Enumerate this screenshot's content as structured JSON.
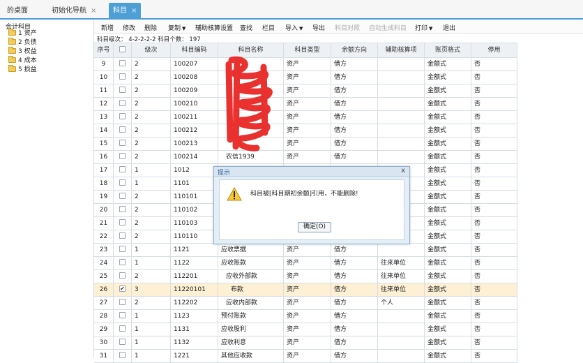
{
  "tabs": [
    {
      "label": "的桌面",
      "closable": false,
      "active": false
    },
    {
      "label": "初始化导航",
      "closable": true,
      "active": false
    },
    {
      "label": "科目",
      "closable": true,
      "active": true
    }
  ],
  "sidebar": {
    "root": "会计科目",
    "items": [
      {
        "label": "1 资产"
      },
      {
        "label": "2 负债"
      },
      {
        "label": "3 权益"
      },
      {
        "label": "4 成本"
      },
      {
        "label": "5 损益"
      }
    ]
  },
  "toolbar": {
    "add": "新增",
    "edit": "修改",
    "delete": "删除",
    "copy": "复制",
    "aux_settings": "辅助核算设置",
    "find": "查找",
    "columns": "栏目",
    "import": "导入",
    "export": "导出",
    "subject_match": "科目对照",
    "auto_generate": "自动生成科目",
    "print": "打印",
    "exit": "退出"
  },
  "summary": "科目级次： 4-2-2-2-2  科目个数： 197",
  "table": {
    "headers": [
      "序号",
      "",
      "级次",
      "科目编码",
      "科目名称",
      "科目类型",
      "余额方向",
      "辅助核算项",
      "账页格式",
      "停用"
    ],
    "rows": [
      {
        "seq": "9",
        "checked": false,
        "level": "2",
        "code": "100207",
        "name": "",
        "type": "资产",
        "dir": "借方",
        "aux": "",
        "format": "金额式",
        "disabled": "否"
      },
      {
        "seq": "10",
        "checked": false,
        "level": "2",
        "code": "100208",
        "name": "",
        "type": "资产",
        "dir": "借方",
        "aux": "",
        "format": "金额式",
        "disabled": "否"
      },
      {
        "seq": "11",
        "checked": false,
        "level": "2",
        "code": "100209",
        "name": "",
        "type": "资产",
        "dir": "借方",
        "aux": "",
        "format": "金额式",
        "disabled": "否"
      },
      {
        "seq": "12",
        "checked": false,
        "level": "2",
        "code": "100210",
        "name": "",
        "type": "资产",
        "dir": "借方",
        "aux": "",
        "format": "金额式",
        "disabled": "否"
      },
      {
        "seq": "13",
        "checked": false,
        "level": "2",
        "code": "100211",
        "name": "",
        "type": "资产",
        "dir": "借方",
        "aux": "",
        "format": "金额式",
        "disabled": "否"
      },
      {
        "seq": "14",
        "checked": false,
        "level": "2",
        "code": "100212",
        "name": "",
        "type": "资产",
        "dir": "借方",
        "aux": "",
        "format": "金额式",
        "disabled": "否"
      },
      {
        "seq": "15",
        "checked": false,
        "level": "2",
        "code": "100213",
        "name": "",
        "type": "资产",
        "dir": "借方",
        "aux": "",
        "format": "金额式",
        "disabled": "否"
      },
      {
        "seq": "16",
        "checked": false,
        "level": "2",
        "code": "100214",
        "name": "农信1939",
        "type": "资产",
        "dir": "借方",
        "aux": "",
        "format": "金额式",
        "disabled": "否"
      },
      {
        "seq": "17",
        "checked": false,
        "level": "1",
        "code": "1012",
        "name": "",
        "type": "",
        "dir": "",
        "aux": "",
        "format": "金额式",
        "disabled": "否"
      },
      {
        "seq": "18",
        "checked": false,
        "level": "1",
        "code": "1101",
        "name": "",
        "type": "",
        "dir": "",
        "aux": "",
        "format": "金额式",
        "disabled": "否"
      },
      {
        "seq": "19",
        "checked": false,
        "level": "2",
        "code": "110101",
        "name": "",
        "type": "",
        "dir": "",
        "aux": "",
        "format": "金额式",
        "disabled": "否"
      },
      {
        "seq": "20",
        "checked": false,
        "level": "2",
        "code": "110102",
        "name": "",
        "type": "",
        "dir": "",
        "aux": "",
        "format": "金额式",
        "disabled": "否"
      },
      {
        "seq": "21",
        "checked": false,
        "level": "2",
        "code": "110103",
        "name": "",
        "type": "",
        "dir": "",
        "aux": "",
        "format": "金额式",
        "disabled": "否"
      },
      {
        "seq": "22",
        "checked": false,
        "level": "2",
        "code": "110110",
        "name": "",
        "type": "",
        "dir": "",
        "aux": "",
        "format": "金额式",
        "disabled": "否"
      },
      {
        "seq": "23",
        "checked": false,
        "level": "1",
        "code": "1121",
        "name": "应收票据",
        "type": "资产",
        "dir": "借方",
        "aux": "",
        "format": "金额式",
        "disabled": "否"
      },
      {
        "seq": "24",
        "checked": false,
        "level": "1",
        "code": "1122",
        "name": "应收账款",
        "type": "资产",
        "dir": "借方",
        "aux": "往来单位",
        "format": "金额式",
        "disabled": "否"
      },
      {
        "seq": "25",
        "checked": false,
        "level": "2",
        "code": "112201",
        "name": "应收外部款",
        "type": "资产",
        "dir": "借方",
        "aux": "往来单位",
        "format": "金额式",
        "disabled": "否"
      },
      {
        "seq": "26",
        "checked": true,
        "level": "3",
        "code": "11220101",
        "name": "布款",
        "type": "资产",
        "dir": "借方",
        "aux": "往来单位",
        "format": "金额式",
        "disabled": "否"
      },
      {
        "seq": "27",
        "checked": false,
        "level": "2",
        "code": "112202",
        "name": "应收内部款",
        "type": "资产",
        "dir": "借方",
        "aux": "个人",
        "format": "金额式",
        "disabled": "否"
      },
      {
        "seq": "28",
        "checked": false,
        "level": "1",
        "code": "1123",
        "name": "预付账款",
        "type": "资产",
        "dir": "借方",
        "aux": "",
        "format": "金额式",
        "disabled": "否"
      },
      {
        "seq": "29",
        "checked": false,
        "level": "1",
        "code": "1131",
        "name": "应收股利",
        "type": "资产",
        "dir": "借方",
        "aux": "",
        "format": "金额式",
        "disabled": "否"
      },
      {
        "seq": "30",
        "checked": false,
        "level": "1",
        "code": "1132",
        "name": "应收利息",
        "type": "资产",
        "dir": "借方",
        "aux": "",
        "format": "金额式",
        "disabled": "否"
      },
      {
        "seq": "31",
        "checked": false,
        "level": "1",
        "code": "1221",
        "name": "其他应收款",
        "type": "资产",
        "dir": "借方",
        "aux": "",
        "format": "金额式",
        "disabled": "否"
      }
    ]
  },
  "dialog": {
    "title": "提示",
    "close_symbol": "x",
    "message": "科目被[科目期初余额]引用，不能删除!",
    "ok_label": "确定(O)",
    "icon": "warning-icon"
  },
  "colors": {
    "accent": "#4d9fd6",
    "selected_row": "#fdf0d4",
    "redaction": "#e8201e"
  }
}
